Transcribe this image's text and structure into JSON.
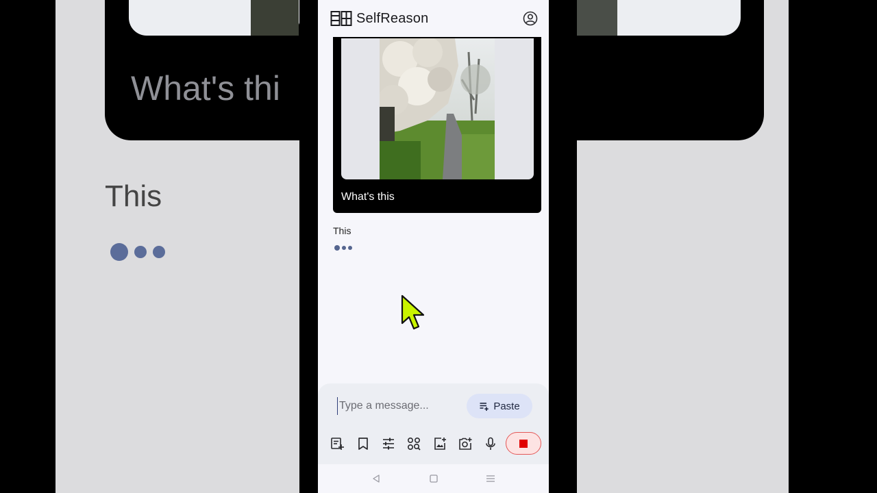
{
  "app": {
    "title": "SelfReason"
  },
  "chat": {
    "user_message": {
      "image_alt": "Flowering tree beside a paved path in a park",
      "text": "What's this"
    },
    "assistant_message": {
      "text": "This",
      "status": "typing"
    }
  },
  "composer": {
    "placeholder": "Type a message...",
    "value": "",
    "paste_label": "Paste"
  },
  "toolbar": {
    "tools": [
      "new-chat-icon",
      "bookmark-icon",
      "tune-icon",
      "image-search-icon",
      "add-image-icon",
      "add-photo-icon",
      "mic-icon"
    ],
    "stop_icon": "stop-icon"
  },
  "nav": {
    "buttons": [
      "back-icon",
      "home-icon",
      "menu-icon"
    ]
  },
  "background": {
    "card_text": "What's thi",
    "response_text": "This"
  },
  "colors": {
    "accent": "#2e3d78",
    "stop_button_bg": "#fde3e3",
    "stop_button_border": "#e45757",
    "stop_icon": "#e00000",
    "paste_button_bg": "#dde3f7",
    "typing_dots": "#55658f",
    "cursor": "#c9f400"
  }
}
